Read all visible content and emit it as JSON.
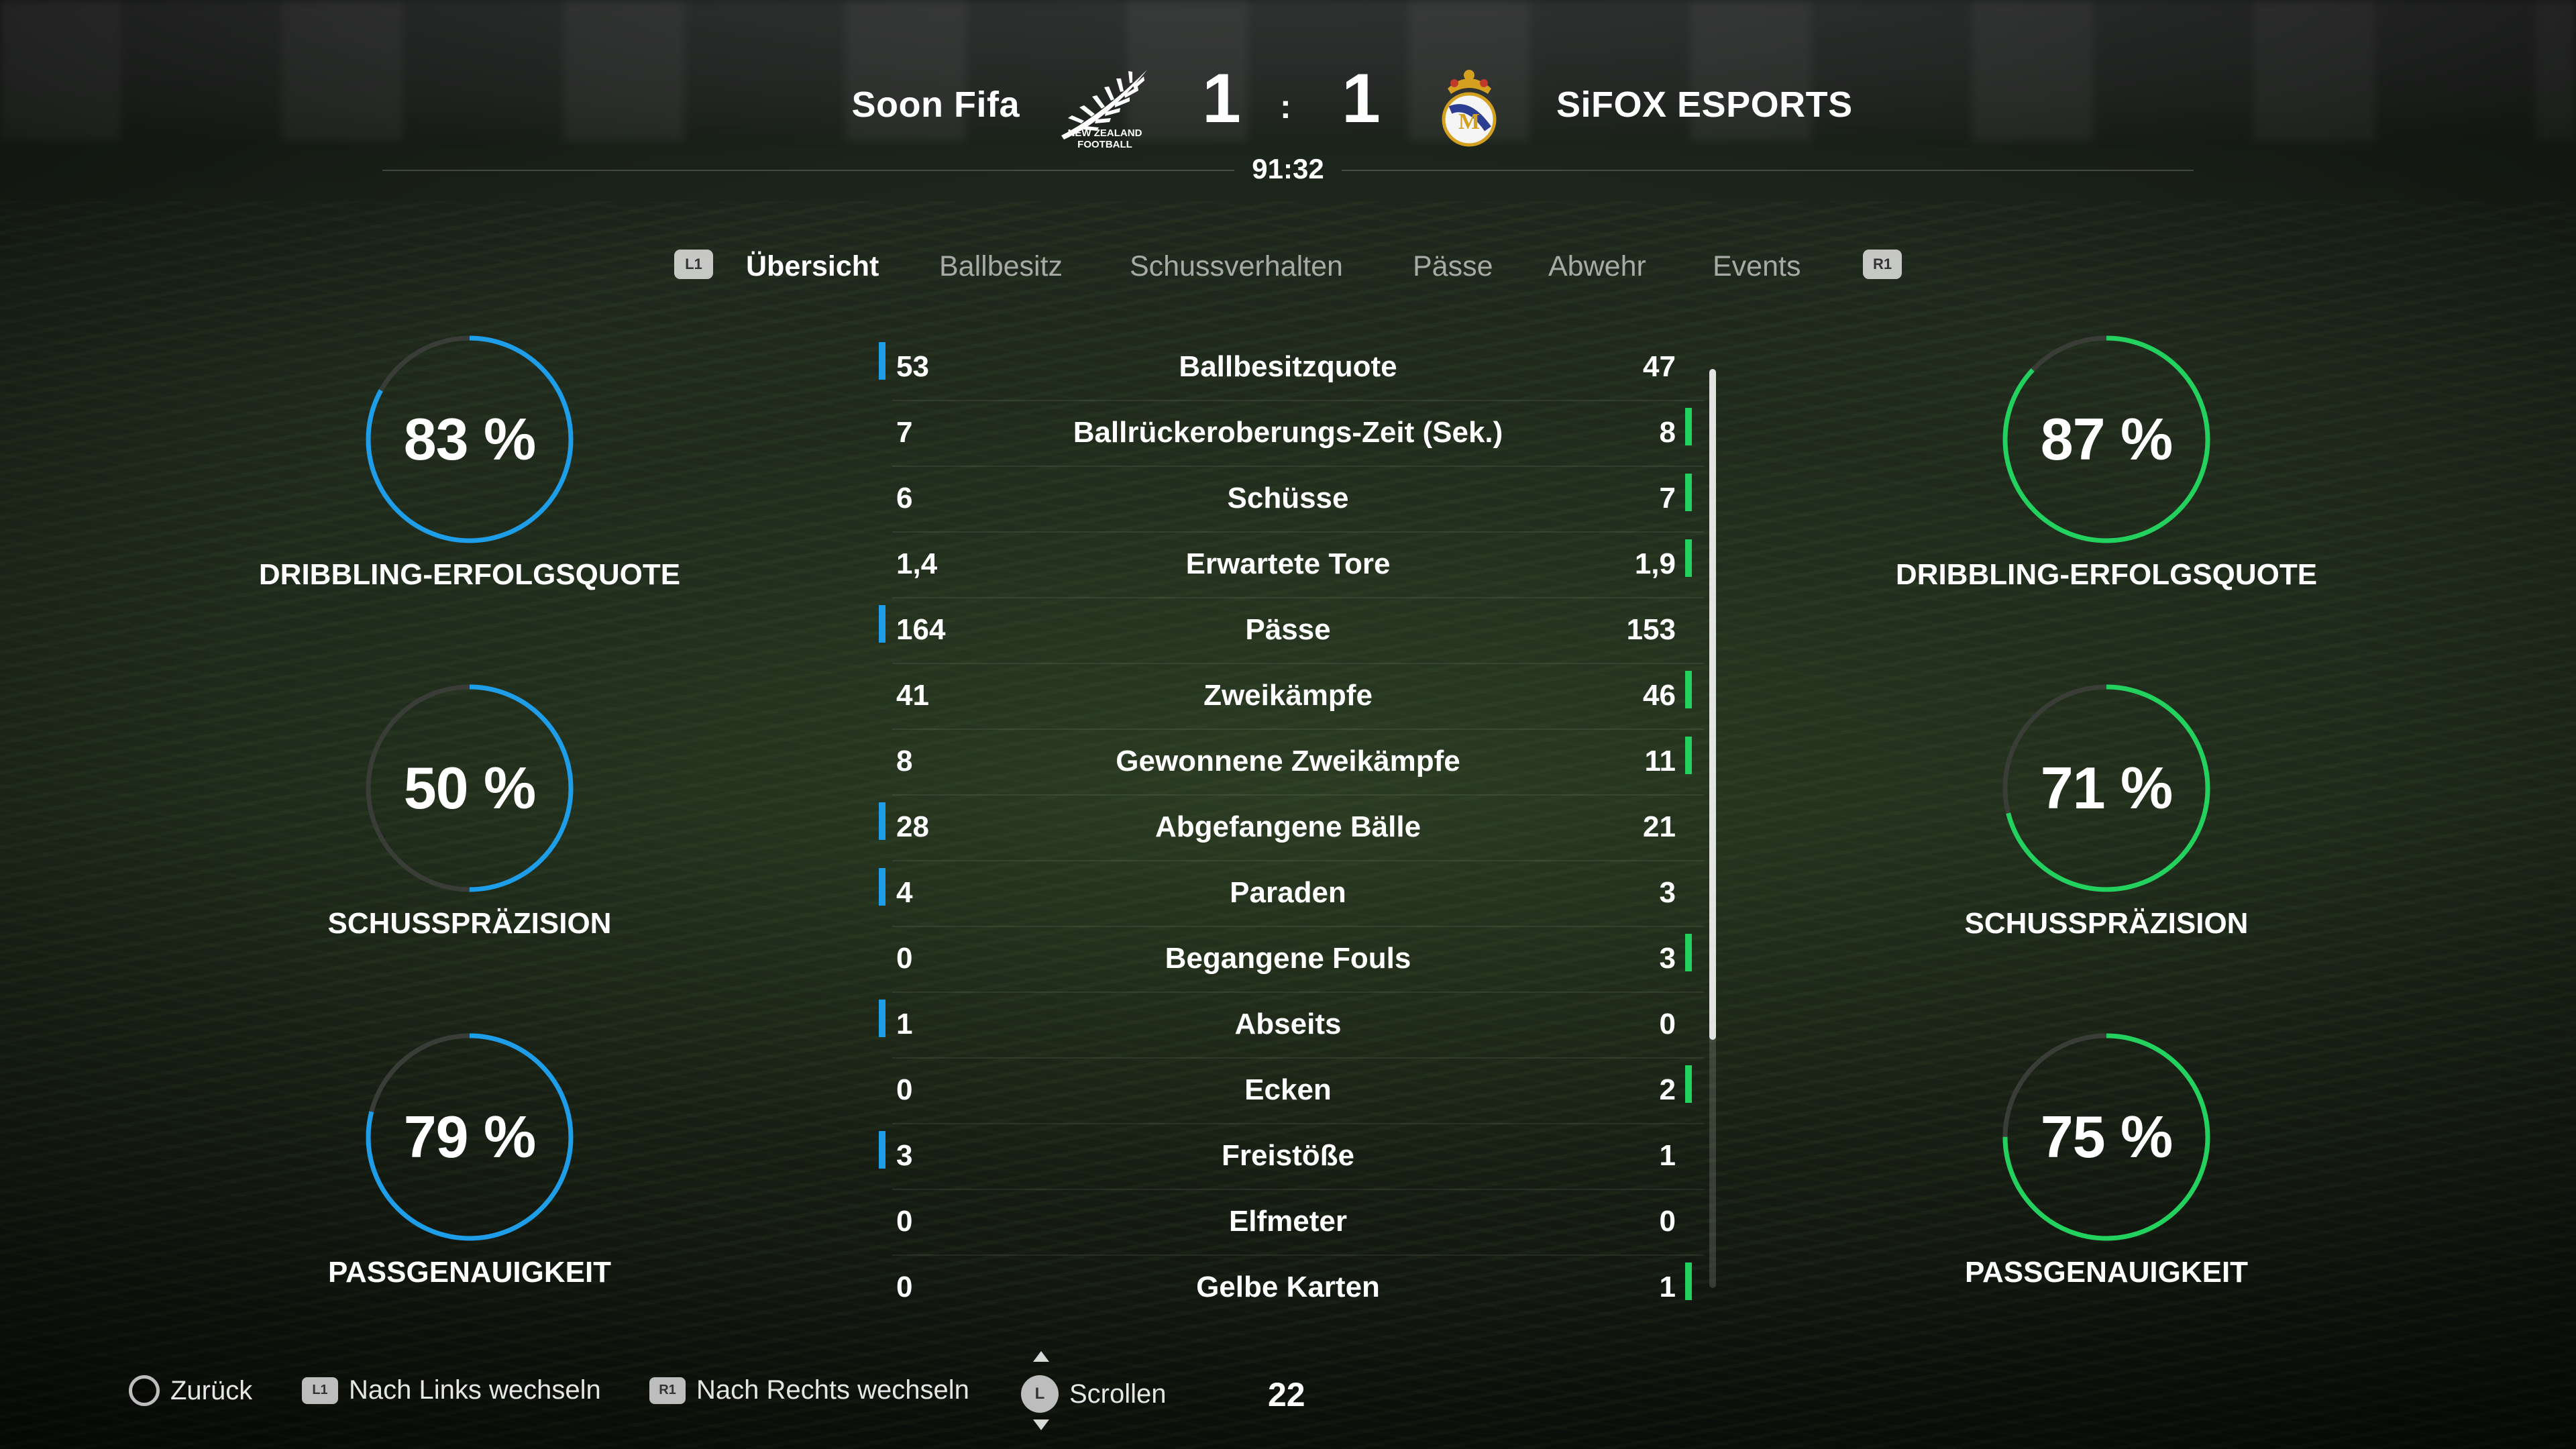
{
  "match": {
    "home_team": "Soon Fifa",
    "away_team": "SiFOX ESPORTS",
    "home_score": "1",
    "away_score": "1",
    "separator": ":",
    "clock": "91:32",
    "home_logo_icon": "new-zealand-fern-logo",
    "home_logo_text_line1": "NEW ZEALAND",
    "home_logo_text_line2": "FOOTBALL",
    "away_logo_icon": "real-madrid-crest"
  },
  "tabs": {
    "left_button": "L1",
    "right_button": "R1",
    "items": [
      "Übersicht",
      "Ballbesitz",
      "Schussverhalten",
      "Pässe",
      "Abwehr",
      "Events"
    ],
    "active": "Übersicht"
  },
  "colors": {
    "home_accent": "#1e9de8",
    "away_accent": "#22d15e",
    "ring_track": "#3a3d37"
  },
  "home_gauges": [
    {
      "value": 83,
      "text": "83 %",
      "label": "DRIBBLING-ERFOLGSQUOTE"
    },
    {
      "value": 50,
      "text": "50 %",
      "label": "SCHUSSPRÄZISION"
    },
    {
      "value": 79,
      "text": "79 %",
      "label": "PASSGENAUIGKEIT"
    }
  ],
  "away_gauges": [
    {
      "value": 87,
      "text": "87 %",
      "label": "DRIBBLING-ERFOLGSQUOTE"
    },
    {
      "value": 71,
      "text": "71 %",
      "label": "SCHUSSPRÄZISION"
    },
    {
      "value": 75,
      "text": "75 %",
      "label": "PASSGENAUIGKEIT"
    }
  ],
  "stats": [
    {
      "label": "Ballbesitzquote",
      "home": "53",
      "away": "47",
      "leader": "home"
    },
    {
      "label": "Ballrückeroberungs-Zeit (Sek.)",
      "home": "7",
      "away": "8",
      "leader": "away"
    },
    {
      "label": "Schüsse",
      "home": "6",
      "away": "7",
      "leader": "away"
    },
    {
      "label": "Erwartete Tore",
      "home": "1,4",
      "away": "1,9",
      "leader": "away"
    },
    {
      "label": "Pässe",
      "home": "164",
      "away": "153",
      "leader": "home"
    },
    {
      "label": "Zweikämpfe",
      "home": "41",
      "away": "46",
      "leader": "away"
    },
    {
      "label": "Gewonnene Zweikämpfe",
      "home": "8",
      "away": "11",
      "leader": "away"
    },
    {
      "label": "Abgefangene Bälle",
      "home": "28",
      "away": "21",
      "leader": "home"
    },
    {
      "label": "Paraden",
      "home": "4",
      "away": "3",
      "leader": "home"
    },
    {
      "label": "Begangene Fouls",
      "home": "0",
      "away": "3",
      "leader": "away"
    },
    {
      "label": "Abseits",
      "home": "1",
      "away": "0",
      "leader": "home"
    },
    {
      "label": "Ecken",
      "home": "0",
      "away": "2",
      "leader": "away"
    },
    {
      "label": "Freistöße",
      "home": "3",
      "away": "1",
      "leader": "home"
    },
    {
      "label": "Elfmeter",
      "home": "0",
      "away": "0",
      "leader": "none"
    },
    {
      "label": "Gelbe Karten",
      "home": "0",
      "away": "1",
      "leader": "away"
    }
  ],
  "footer": {
    "back_label": "Zurück",
    "left_label": "Nach Links wechseln",
    "left_button": "L1",
    "right_label": "Nach Rechts wechseln",
    "right_button": "R1",
    "scroll_label": "Scrollen",
    "scroll_button": "L",
    "counter": "22"
  }
}
